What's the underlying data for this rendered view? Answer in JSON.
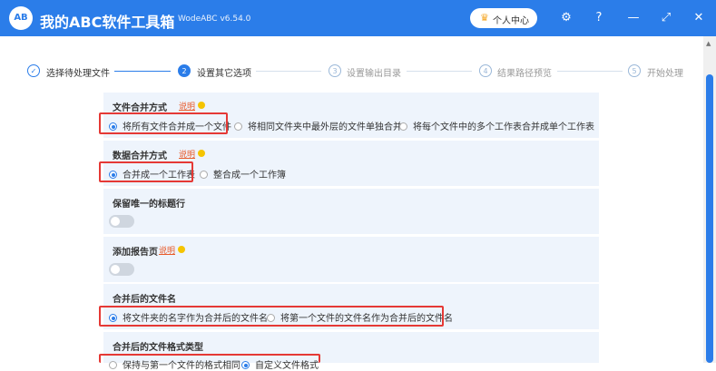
{
  "app": {
    "logo_text": "AB",
    "title": "我的ABC软件工具箱",
    "version": "WodeABC v6.54.0",
    "user_center": "个人中心"
  },
  "icons": {
    "crown": "crown-icon",
    "settings": "gear-icon",
    "help": "question-icon",
    "minimize": "minimize-icon",
    "maximize": "maximize-icon",
    "close": "close-icon"
  },
  "colors": {
    "accent": "#2b7de9",
    "highlight": "#e53935",
    "help": "#e85a2a"
  },
  "steps": [
    {
      "num": "✓",
      "label": "选择待处理文件",
      "state": "done"
    },
    {
      "num": "2",
      "label": "设置其它选项",
      "state": "active"
    },
    {
      "num": "3",
      "label": "设置输出目录",
      "state": "pending"
    },
    {
      "num": "4",
      "label": "结果路径预览",
      "state": "pending"
    },
    {
      "num": "5",
      "label": "开始处理",
      "state": "pending"
    }
  ],
  "sections": {
    "merge_method": {
      "title": "文件合并方式",
      "help": "说明",
      "options": [
        "将所有文件合并成一个文件",
        "将相同文件夹中最外层的文件单独合并",
        "将每个文件中的多个工作表合并成单个工作表"
      ],
      "selected": 0
    },
    "data_merge": {
      "title": "数据合并方式",
      "help": "说明",
      "options": [
        "合并成一个工作表",
        "整合成一个工作簿"
      ],
      "selected": 0
    },
    "keep_header": {
      "title": "保留唯一的标题行",
      "enabled": false
    },
    "add_report": {
      "title": "添加报告页",
      "help": "说明",
      "enabled": false
    },
    "merged_name": {
      "title": "合并后的文件名",
      "options": [
        "将文件夹的名字作为合并后的文件名",
        "将第一个文件的文件名作为合并后的文件名"
      ],
      "selected": 0
    },
    "merged_format": {
      "title": "合并后的文件格式类型",
      "options": [
        "保持与第一个文件的格式相同",
        "自定义文件格式"
      ],
      "selected": 1
    }
  }
}
